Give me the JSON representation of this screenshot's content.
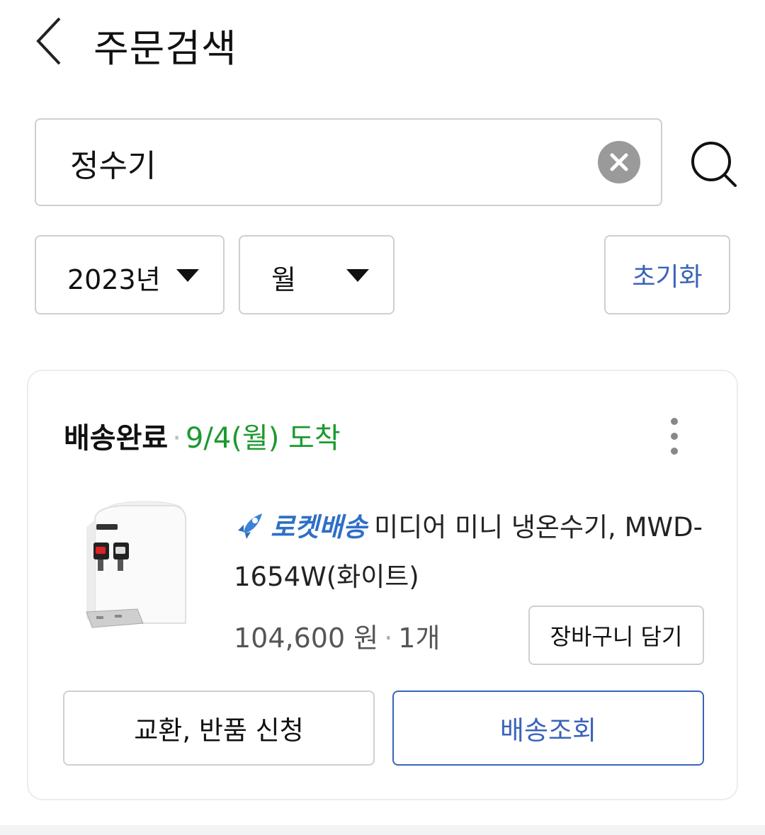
{
  "header": {
    "title": "주문검색",
    "back_icon": "chevron-left-icon"
  },
  "search": {
    "value": "정수기",
    "placeholder": "",
    "clear_icon": "clear-x-icon",
    "search_icon": "magnifier-icon"
  },
  "filters": {
    "year": "2023년",
    "month": "월",
    "reset_label": "초기화",
    "dropdown_icon": "triangle-down-icon"
  },
  "order": {
    "status": "배송완료",
    "separator": "·",
    "arrival": "9/4(월) 도착",
    "more_icon": "vertical-dots-icon",
    "product": {
      "badge_icon": "rocket-icon",
      "badge_label": "로켓배송",
      "name": "미디어 미니 냉온수기, MWD-1654W(화이트)",
      "price": "104,600 원",
      "quantity": "1개",
      "image_icon": "water-dispenser-image"
    },
    "cart_label": "장바구니 담기",
    "exchange_label": "교환, 반품 신청",
    "track_label": "배송조회"
  },
  "colors": {
    "accent_blue": "#3a63b8",
    "status_green": "#1b9a2e",
    "rocket_blue": "#2e6fc7",
    "border_gray": "#cfcfcf"
  }
}
